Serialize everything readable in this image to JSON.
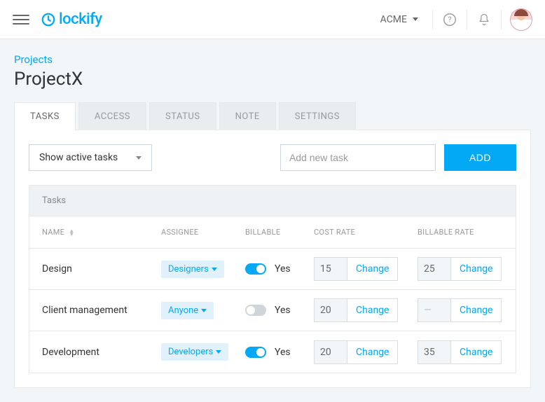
{
  "header": {
    "logo_text": "lockify",
    "workspace": "ACME"
  },
  "breadcrumb": "Projects",
  "page_title": "ProjectX",
  "tabs": [
    {
      "label": "TASKS",
      "active": true
    },
    {
      "label": "ACCESS",
      "active": false
    },
    {
      "label": "STATUS",
      "active": false
    },
    {
      "label": "NOTE",
      "active": false
    },
    {
      "label": "SETTINGS",
      "active": false
    }
  ],
  "toolbar": {
    "filter_label": "Show active tasks",
    "add_placeholder": "Add new task",
    "add_button": "ADD"
  },
  "table": {
    "title": "Tasks",
    "columns": {
      "name": "NAME",
      "assignee": "ASSIGNEE",
      "billable": "BILLABLE",
      "cost_rate": "COST RATE",
      "billable_rate": "BILLABLE RATE"
    },
    "change_label": "Change",
    "billable_yes": "Yes",
    "rows": [
      {
        "name": "Design",
        "assignee": "Designers",
        "billable_on": true,
        "cost_rate": "15",
        "billable_rate": "25"
      },
      {
        "name": "Client management",
        "assignee": "Anyone",
        "billable_on": false,
        "cost_rate": "20",
        "billable_rate": "—"
      },
      {
        "name": "Development",
        "assignee": "Developers",
        "billable_on": true,
        "cost_rate": "20",
        "billable_rate": "35"
      }
    ]
  }
}
